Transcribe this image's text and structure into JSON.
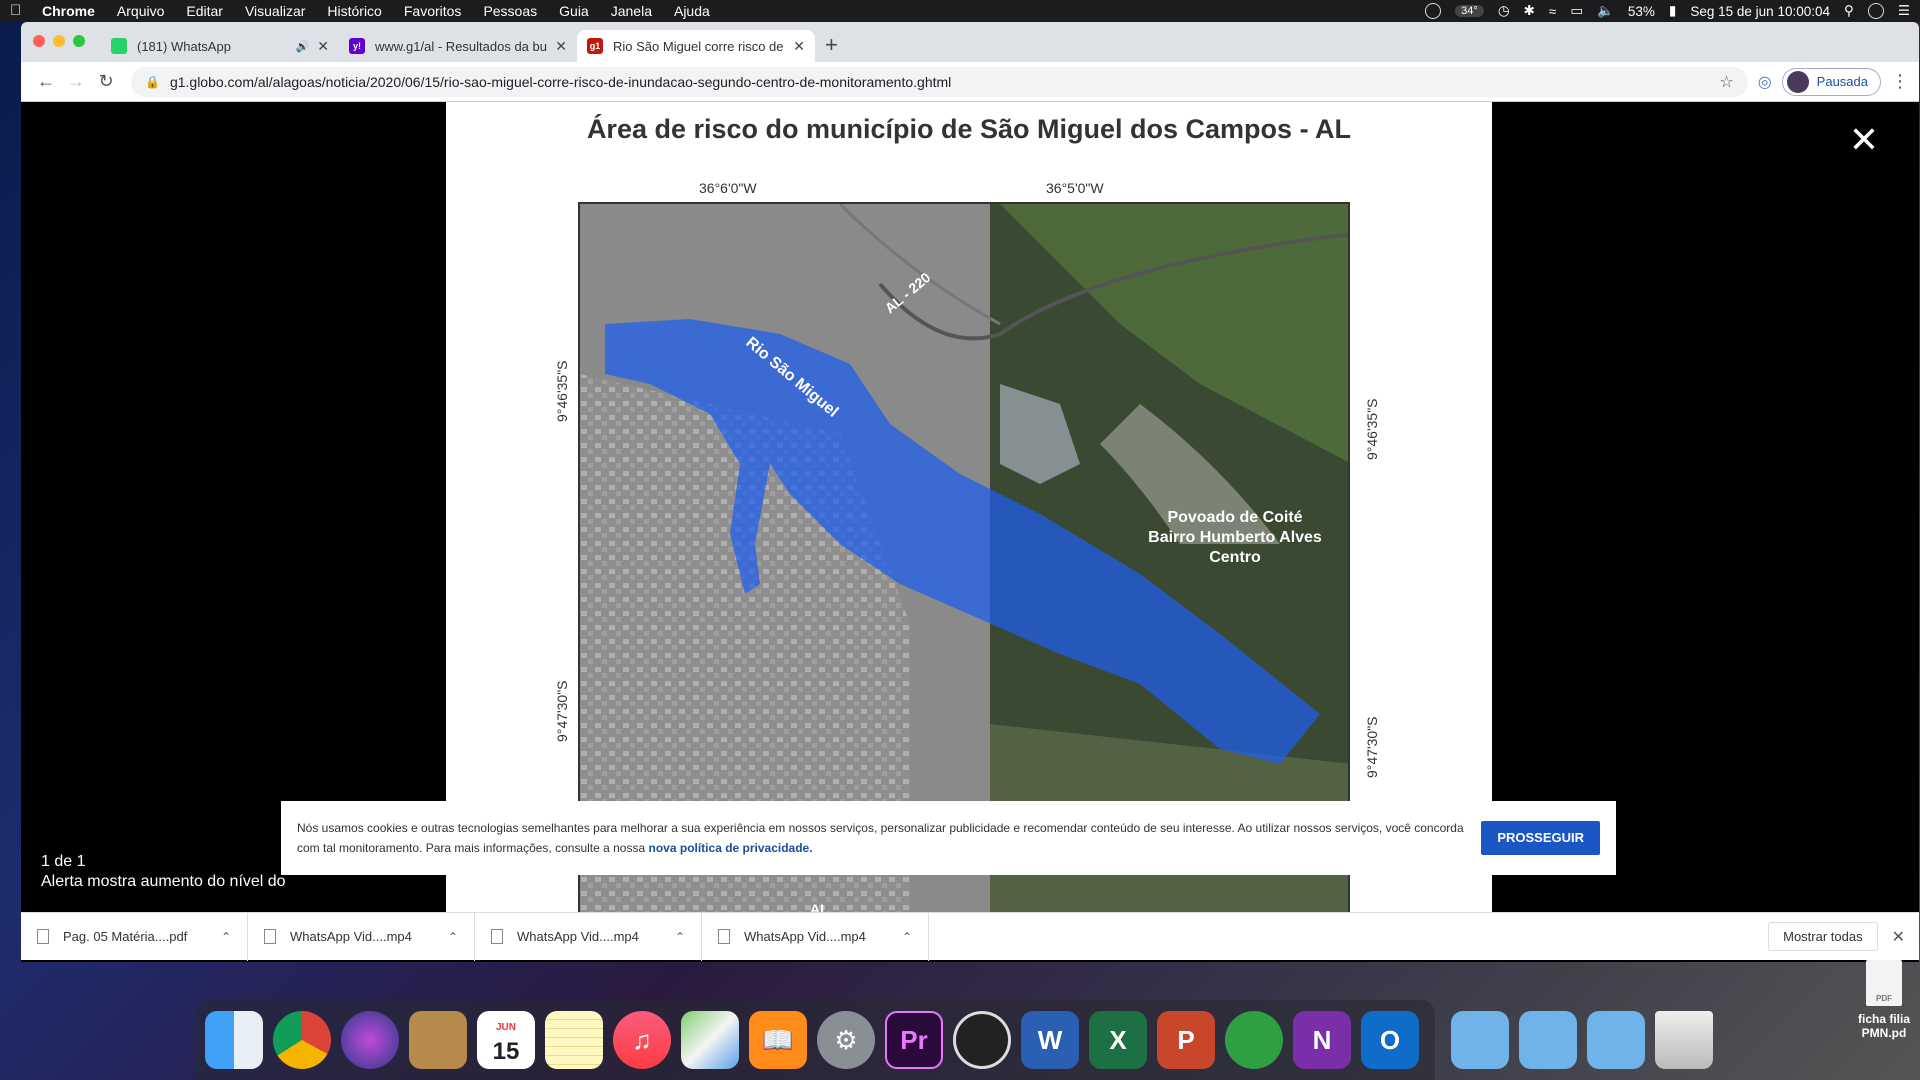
{
  "menubar": {
    "app": "Chrome",
    "items": [
      "Arquivo",
      "Editar",
      "Visualizar",
      "Histórico",
      "Favoritos",
      "Pessoas",
      "Guia",
      "Janela",
      "Ajuda"
    ],
    "temperature": "34°",
    "battery": "53%",
    "clock": "Seg 15 de jun  10:00:04"
  },
  "tabs": [
    {
      "title": "(181) WhatsApp",
      "favicon_color": "#25d366"
    },
    {
      "title": "www.g1/al - Resultados da bus",
      "favicon_color": "#6001d2"
    },
    {
      "title": "Rio São Miguel corre risco de i",
      "favicon_color": "#c4170c"
    }
  ],
  "address": {
    "url": "g1.globo.com/al/alagoas/noticia/2020/06/15/rio-sao-miguel-corre-risco-de-inundacao-segundo-centro-de-monitoramento.ghtml"
  },
  "profile": {
    "label": "Pausada"
  },
  "figure": {
    "title": "Área de risco do município de São Miguel dos Campos - AL",
    "lon1": "36°6'0\"W",
    "lon2": "36°5'0\"W",
    "lat_left_top": "9°46'35\"S",
    "lat_left_bottom": "9°47'30\"S",
    "lat_right_top": "9°46'35\"S",
    "lat_right_bottom": "9°47'30\"S",
    "river_label": "Rio São Miguel",
    "road_label": "AL - 220",
    "road_label2": "AL",
    "area_line1": "Povoado de Coité",
    "area_line2": "Bairro Humberto Alves",
    "area_line3": "Centro"
  },
  "viewer": {
    "counter": "1 de 1",
    "caption": "Alerta mostra aumento do nível do"
  },
  "cookie": {
    "text": "Nós usamos cookies e outras tecnologias semelhantes para melhorar a sua experiência em nossos serviços, personalizar publicidade e recomendar conteúdo de seu interesse. Ao utilizar nossos serviços, você concorda com tal monitoramento. Para mais informações, consulte a nossa",
    "link": "nova política de privacidade.",
    "button": "PROSSEGUIR"
  },
  "downloads": {
    "items": [
      "Pag. 05 Matéria....pdf",
      "WhatsApp Vid....mp4",
      "WhatsApp Vid....mp4",
      "WhatsApp Vid....mp4"
    ],
    "show_all": "Mostrar todas"
  },
  "dock": {
    "calendar_month": "JUN",
    "calendar_day": "15"
  },
  "desktop": {
    "file_label": "ficha filia PMN.pd",
    "file_icon_text": "PDF"
  }
}
